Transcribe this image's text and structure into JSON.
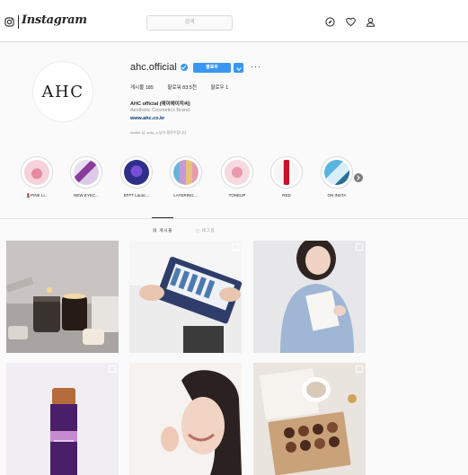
{
  "nav": {
    "logo_text": "Instagram",
    "search_placeholder": "검색",
    "icons": [
      "instagram-glyph-icon",
      "compass-icon",
      "heart-icon",
      "person-icon"
    ]
  },
  "profile": {
    "username": "ahc.official",
    "avatar_text": "AHC",
    "follow_label": "팔로우",
    "stats": {
      "posts": "게시물 185",
      "followers": "팔로워 83.5천",
      "following": "팔로우 1"
    },
    "bio_name": "AHC official (에이에이치씨)",
    "bio_category": "Aesthetic Cosmetics Brand",
    "bio_link": "www.ahc.co.kr",
    "followed_by": "lmaliia 님, sully_a 님이 팔로우합니다"
  },
  "highlights": [
    {
      "label": "💄PINK LI...",
      "color": "#f2b8c6"
    },
    {
      "label": "NEW EYEC...",
      "color": "#8a3c9e"
    },
    {
      "label": "EFFT Launc...",
      "color": "#2f2f8a"
    },
    {
      "label": "LAYERING ...",
      "color": "#c79ad6"
    },
    {
      "label": "TONEUP",
      "color": "#f0b9c3"
    },
    {
      "label": "RED",
      "color": "#c8102e"
    },
    {
      "label": "ON INSTA",
      "color": "#5ab4e0"
    }
  ],
  "tabs": {
    "posts": "게시물",
    "tagged": "태그됨"
  },
  "colors": {
    "accent": "#3897f0",
    "text": "#262626",
    "muted": "#8e8e8e",
    "link": "#00376b"
  }
}
